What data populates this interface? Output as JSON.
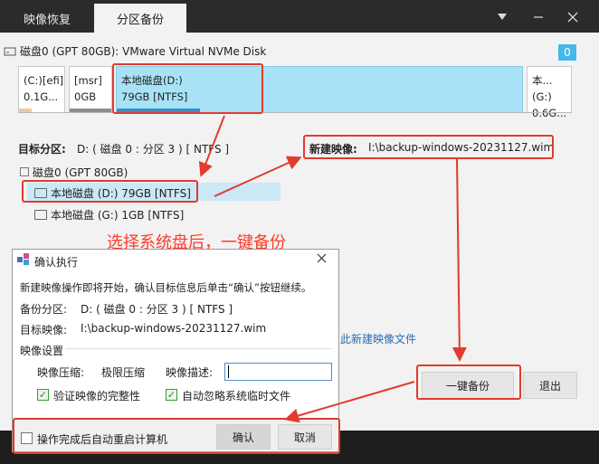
{
  "tabs": {
    "restore": "映像恢复",
    "backup": "分区备份"
  },
  "window": {
    "badge": "0"
  },
  "disk": {
    "title": "磁盘0 (GPT 80GB): VMware Virtual NVMe Disk"
  },
  "partitions": [
    {
      "name": "(C:)[efi]",
      "size": "0.1G..."
    },
    {
      "name": "[msr]",
      "size": "0GB"
    },
    {
      "name": "本地磁盘(D:)",
      "size": "79GB [NTFS]"
    },
    {
      "name": "本...(G:)",
      "size": "0.6G..."
    }
  ],
  "target": {
    "label": "目标分区:",
    "value": "D: ( 磁盘 0 : 分区 3 ) [ NTFS ]",
    "tree_root": "磁盘0 (GPT 80GB)",
    "tree_item1": "本地磁盘 (D:) 79GB [NTFS]",
    "tree_item2": "本地磁盘 (G:) 1GB [NTFS]"
  },
  "new_image": {
    "label": "新建映像:",
    "path": "I:\\backup-windows-20231127.wim"
  },
  "annotation": "选择系统盘后，一键备份",
  "buttons": {
    "one_click": "一键备份",
    "exit": "退出"
  },
  "link_partial": "此新建映像文件",
  "dialog": {
    "title": "确认执行",
    "message": "新建映像操作即将开始，确认目标信息后单击“确认”按钮继续。",
    "backup_label": "备份分区:",
    "backup_value": "D: ( 磁盘 0 : 分区 3 ) [ NTFS ]",
    "target_label": "目标映像:",
    "target_value": "I:\\backup-windows-20231127.wim",
    "settings_label": "映像设置",
    "compress_label": "映像压缩:",
    "compress_value": "极限压缩",
    "desc_label": "映像描述:",
    "desc_value": "",
    "verify_label": "验证映像的完整性",
    "ignore_label": "自动忽略系统临时文件",
    "restart_label": "操作完成后自动重启计算机",
    "confirm": "确认",
    "cancel": "取消"
  },
  "colors": {
    "accent": "#46b7ea",
    "selected_partition": "#a8e2f7",
    "annotation_red": "#e23a2f"
  }
}
